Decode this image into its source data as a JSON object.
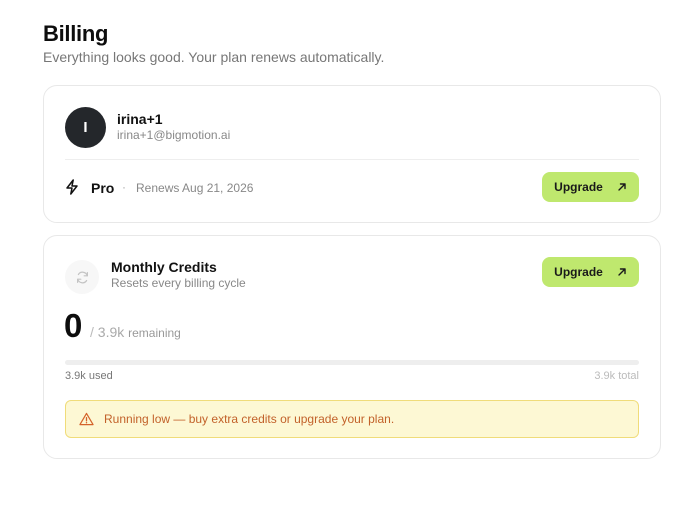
{
  "header": {
    "title": "Billing",
    "subtitle": "Everything looks good. Your plan renews automatically."
  },
  "account": {
    "avatar_initial": "I",
    "name": "irina+1",
    "email": "irina+1@bigmotion.ai",
    "plan": {
      "name": "Pro",
      "separator": "·",
      "renews_text": "Renews Aug 21, 2026",
      "icon": "bolt-icon"
    },
    "upgrade_label": "Upgrade"
  },
  "credits": {
    "icon": "refresh-icon",
    "title": "Monthly Credits",
    "subtitle": "Resets every billing cycle",
    "value": "0",
    "separator": "/",
    "total": "3.9k",
    "remaining_label": "remaining",
    "used_label": "3.9k used",
    "total_label": "3.9k total",
    "remaining_fraction": 0,
    "upgrade_label": "Upgrade"
  },
  "alert": {
    "icon": "warning-icon",
    "text": "Running low — buy extra credits or upgrade your plan."
  },
  "colors": {
    "accent": "#bfe86e",
    "avatar_bg": "#24272b",
    "alert_bg": "#fdf8d4",
    "alert_border": "#f0dc7a",
    "alert_text": "#c2612a"
  }
}
